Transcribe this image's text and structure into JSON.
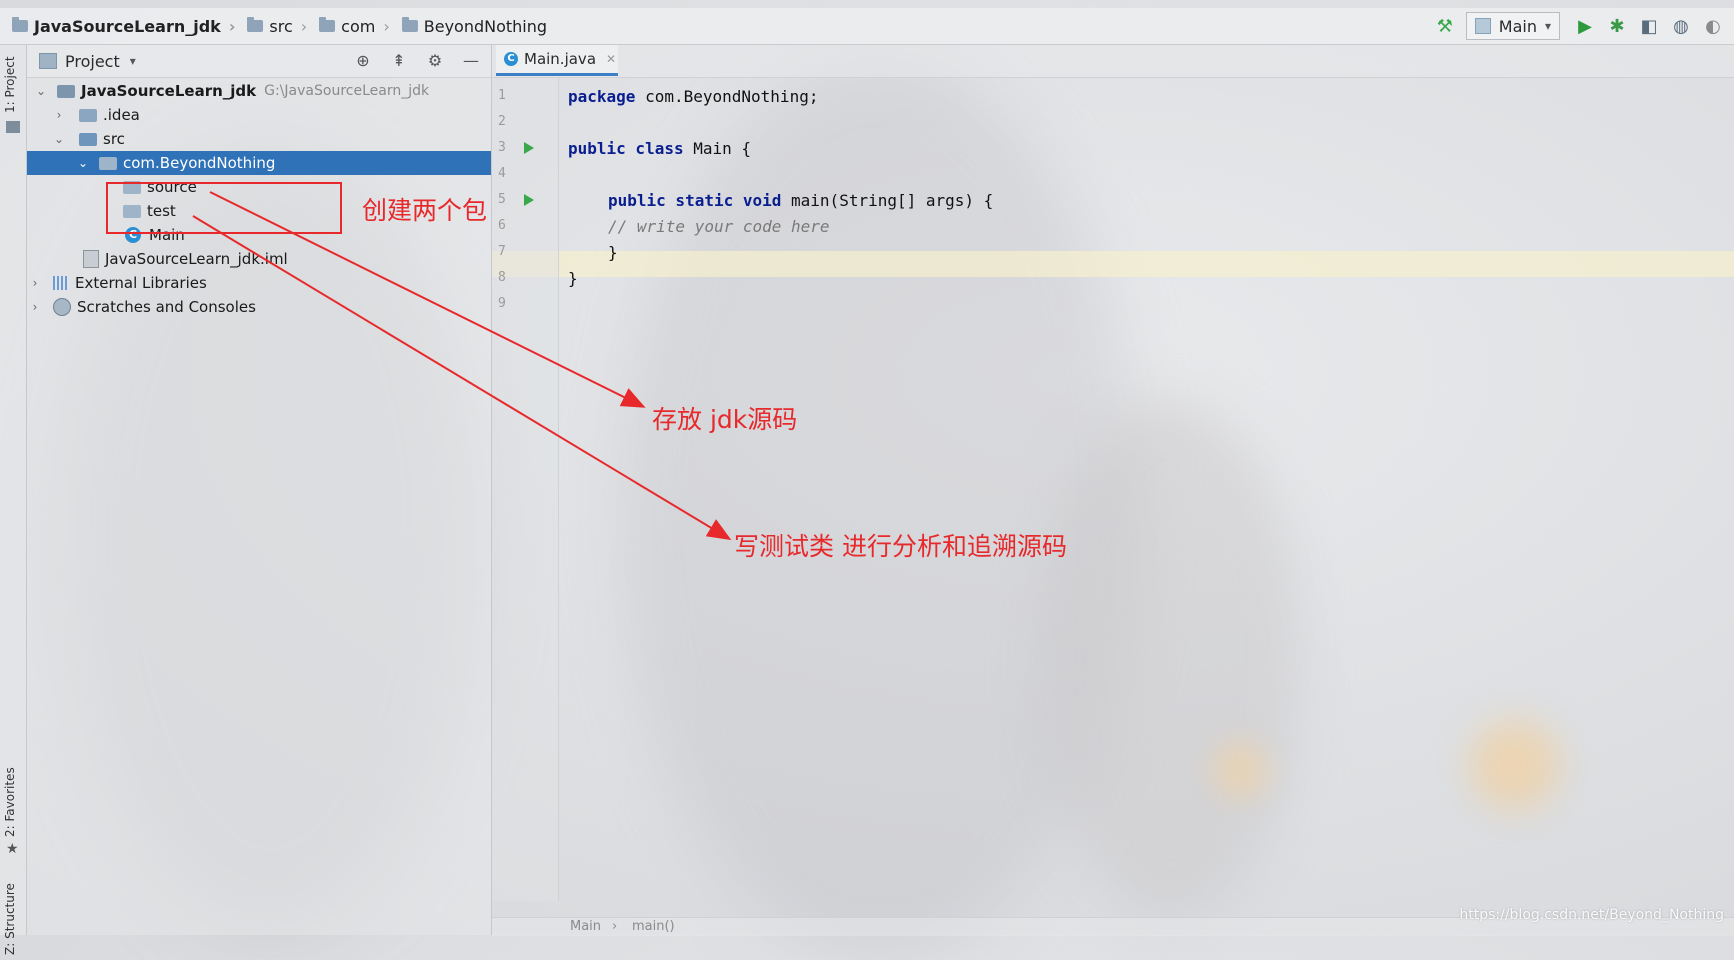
{
  "navbar": {
    "crumbs": [
      "JavaSourceLearn_jdk",
      "src",
      "com",
      "BeyondNothing"
    ],
    "run_config": "Main"
  },
  "tool_stripe": {
    "project": "1: Project",
    "favorites": "2: Favorites",
    "structure": "Z: Structure"
  },
  "project_panel": {
    "title": "Project",
    "tree": {
      "root_label": "JavaSourceLearn_jdk",
      "root_path": "G:\\JavaSourceLearn_jdk",
      "idea": ".idea",
      "src": "src",
      "package": "com.BeyondNothing",
      "source": "source",
      "test": "test",
      "main": "Main",
      "iml": "JavaSourceLearn_jdk.iml",
      "ext_libs": "External Libraries",
      "scratches": "Scratches and Consoles"
    }
  },
  "editor": {
    "tab_label": "Main.java",
    "line_numbers": [
      "1",
      "2",
      "3",
      "4",
      "5",
      "6",
      "7",
      "8",
      "9"
    ],
    "code": {
      "line1_kw": "package",
      "line1_rest": " com.BeyondNothing;",
      "line3_kw": "public class",
      "line3_rest": " Main {",
      "line5_kw": "public static void",
      "line5_rest": " main(String[] args) {",
      "line6_comment": "// write your code here",
      "line7": "}",
      "line8": "}"
    },
    "status": {
      "left": "Main",
      "right": "main()"
    }
  },
  "annotations": {
    "create_packages": "创建两个包",
    "store_source": "存放 jdk源码",
    "write_test": "写测试类 进行分析和追溯源码",
    "color": "#e8292b"
  },
  "watermark": "https://blog.csdn.net/Beyond_Nothing"
}
